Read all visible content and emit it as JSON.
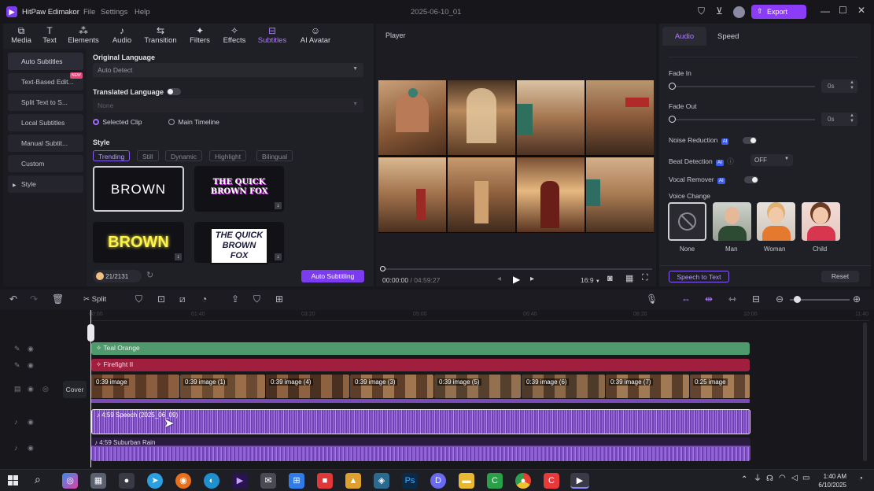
{
  "app": {
    "name": "HitPaw Edimakor",
    "menu": [
      "File",
      "Settings",
      "Help"
    ],
    "project_title": "2025-06-10_01",
    "export_label": "Export"
  },
  "toolbar_tabs": [
    {
      "label": "Media",
      "icon": "media-icon"
    },
    {
      "label": "Text",
      "icon": "text-icon"
    },
    {
      "label": "Elements",
      "icon": "elements-icon"
    },
    {
      "label": "Audio",
      "icon": "audio-icon"
    },
    {
      "label": "Transition",
      "icon": "transition-icon"
    },
    {
      "label": "Filters",
      "icon": "filters-icon"
    },
    {
      "label": "Effects",
      "icon": "effects-icon"
    },
    {
      "label": "Subtitles",
      "icon": "subtitles-icon",
      "active": true
    },
    {
      "label": "AI Avatar",
      "icon": "avatar-icon"
    }
  ],
  "subtitle_nav": [
    "Auto Subtitles",
    "Text-Based Edit...",
    "Split Text to S...",
    "Local Subtitles",
    "Manual Subtit...",
    "Custom",
    "Style"
  ],
  "new_badge": "NEW",
  "subtitles_form": {
    "original_language_label": "Original Language",
    "original_language_value": "Auto Detect",
    "translated_language_label": "Translated Language",
    "translated_language_value": "None",
    "radio_selected_clip": "Selected Clip",
    "radio_main_timeline": "Main Timeline",
    "style_label": "Style",
    "style_chips": [
      "Trending",
      "Still",
      "Dynamic",
      "Highlight",
      "Bilingual"
    ],
    "style_previews": [
      "BROWN",
      "THE QUICK BROWN FOX",
      "BROWN",
      "THE QUICK BROWN FOX"
    ],
    "credits": "21/2131",
    "auto_subtitling_label": "Auto Subtitling"
  },
  "player": {
    "title": "Player",
    "time_current": "00:00:00",
    "time_total": "04:59:27",
    "aspect": "16:9"
  },
  "audio_panel": {
    "tabs": [
      "Audio",
      "Speed"
    ],
    "fade_in_label": "Fade In",
    "fade_in_value": "0s",
    "fade_out_label": "Fade Out",
    "fade_out_value": "0s",
    "noise_reduction_label": "Noise Reduction",
    "beat_detection_label": "Beat Detection",
    "beat_detection_value": "OFF",
    "vocal_remover_label": "Vocal Remover",
    "ai_badge": "AI",
    "voice_change_label": "Voice Change",
    "voices": [
      "None",
      "Man",
      "Woman",
      "Child"
    ],
    "speech_to_text_label": "Speech to Text",
    "reset_label": "Reset"
  },
  "edit_toolbar": {
    "split_label": "Split"
  },
  "timeline": {
    "ruler": [
      "00:00",
      "01:40",
      "03:20",
      "05:00",
      "06:40",
      "08:20",
      "10:00"
    ],
    "cover_label": "Cover",
    "tracks": {
      "filter": "Teal Orange",
      "effect": "Firefight II",
      "video_clips": [
        "0:39 image",
        "0:39 image (1)",
        "0:39 image (4)",
        "0:39 image (3)",
        "0:39 image (5)",
        "0:39 image (6)",
        "0:39 image (7)",
        "0:25 image"
      ],
      "speech": "4:59 Speech (2025_06_09)",
      "music": "4:59 Suburban Rain"
    }
  },
  "taskbar": {
    "time": "1:40 AM",
    "date": "6/10/2025"
  },
  "colors": {
    "accent": "#8b3cf6",
    "filter_track": "#4e9a6c",
    "effect_track": "#a01e3e",
    "audio_track": "#7a4ab8"
  }
}
